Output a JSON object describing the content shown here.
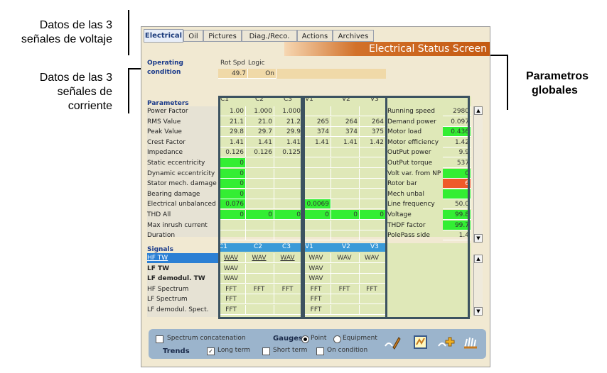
{
  "annotations": {
    "voltage": [
      "Datos de las 3",
      "señales de voltaje"
    ],
    "current": [
      "Datos de las 3",
      "señales de",
      "corriente"
    ],
    "global": [
      "Parametros",
      "globales"
    ]
  },
  "tabs": [
    "Electrical",
    "Oil",
    "Pictures",
    "Diag./Reco.",
    "Actions",
    "Archives"
  ],
  "title": "Electrical Status Screen",
  "operating": {
    "label1": "Operating",
    "label2": "condition",
    "rot_spd": "Rot Spd",
    "logic": "Logic",
    "rot_value": "49.7",
    "logic_value": "On"
  },
  "parameters": {
    "heading": "Parameters",
    "c_headers": [
      "C1",
      "C2",
      "C3"
    ],
    "v_headers": [
      "V1",
      "V2",
      "V3"
    ],
    "rows": [
      {
        "label": "Power Factor",
        "c": [
          "1.00",
          "1.000",
          "1.000"
        ],
        "v": [
          "",
          "",
          ""
        ]
      },
      {
        "label": "RMS Value",
        "c": [
          "21.1",
          "21.0",
          "21.2"
        ],
        "v": [
          "265",
          "264",
          "264"
        ]
      },
      {
        "label": "Peak Value",
        "c": [
          "29.8",
          "29.7",
          "29.9"
        ],
        "v": [
          "374",
          "374",
          "375"
        ]
      },
      {
        "label": "Crest Factor",
        "c": [
          "1.41",
          "1.41",
          "1.41"
        ],
        "v": [
          "1.41",
          "1.41",
          "1.42"
        ]
      },
      {
        "label": "Impedance",
        "c": [
          "0.126",
          "0.126",
          "0.125"
        ],
        "v": [
          "",
          "",
          ""
        ]
      },
      {
        "label": "Static eccentricity",
        "c": [
          "0",
          "",
          ""
        ],
        "v": [
          "",
          "",
          ""
        ]
      },
      {
        "label": "Dynamic eccentricity",
        "c": [
          "0",
          "",
          ""
        ],
        "v": [
          "",
          "",
          ""
        ]
      },
      {
        "label": "Stator mech. damage",
        "c": [
          "0",
          "",
          ""
        ],
        "v": [
          "",
          "",
          ""
        ]
      },
      {
        "label": "Bearing damage",
        "c": [
          "0",
          "",
          ""
        ],
        "v": [
          "",
          "",
          ""
        ]
      },
      {
        "label": "Electrical unbalanced",
        "c": [
          "0.076",
          "",
          ""
        ],
        "v": [
          "0.0069",
          "",
          ""
        ]
      },
      {
        "label": "THD All",
        "c": [
          "0",
          "0",
          "0"
        ],
        "v": [
          "0",
          "0",
          "0"
        ]
      },
      {
        "label": "Max inrush current",
        "c": [
          "",
          "",
          ""
        ],
        "v": [
          "",
          "",
          ""
        ]
      },
      {
        "label": "Duration",
        "c": [
          "",
          "",
          ""
        ],
        "v": [
          "",
          "",
          ""
        ]
      }
    ]
  },
  "global": [
    {
      "label": "Running speed",
      "value": "2980",
      "color": ""
    },
    {
      "label": "Demand power",
      "value": "0.097",
      "color": ""
    },
    {
      "label": "Motor load",
      "value": "0.436",
      "color": "g"
    },
    {
      "label": "Motor efficiency",
      "value": "1.42",
      "color": ""
    },
    {
      "label": "OutPut power",
      "value": "9.9",
      "color": ""
    },
    {
      "label": "OutPut torque",
      "value": "537",
      "color": ""
    },
    {
      "label": "Volt var. from NP",
      "value": "0",
      "color": "g"
    },
    {
      "label": "Rotor bar damage",
      "value": "6",
      "color": "r"
    },
    {
      "label": "Mech unbal misalig",
      "value": "",
      "color": "g"
    },
    {
      "label": "Line frequency",
      "value": "50.0",
      "color": ""
    },
    {
      "label": "Voltage Distorsion",
      "value": "99.8",
      "color": "g"
    },
    {
      "label": "THDF factor",
      "value": "99.7",
      "color": "g"
    },
    {
      "label": "PolePass side band",
      "value": "1.4",
      "color": ""
    }
  ],
  "signals": {
    "heading": "Signals",
    "rows": [
      {
        "label": "HF TW",
        "c": [
          "WAV",
          "WAV",
          "WAV"
        ],
        "v": [
          "WAV",
          "WAV",
          "WAV"
        ],
        "sel": true
      },
      {
        "label": "LF TW",
        "c": [
          "WAV",
          "",
          ""
        ],
        "v": [
          "WAV",
          "",
          ""
        ],
        "bold": true
      },
      {
        "label": "LF demodul. TW",
        "c": [
          "WAV",
          "",
          ""
        ],
        "v": [
          "WAV",
          "",
          ""
        ],
        "bold": true
      },
      {
        "label": "HF Spectrum",
        "c": [
          "FFT",
          "FFT",
          "FFT"
        ],
        "v": [
          "FFT",
          "FFT",
          "FFT"
        ]
      },
      {
        "label": "LF Spectrum",
        "c": [
          "FFT",
          "",
          ""
        ],
        "v": [
          "FFT",
          "",
          ""
        ]
      },
      {
        "label": "LF demodul. Spect.",
        "c": [
          "FFT",
          "",
          ""
        ],
        "v": [
          "FFT",
          "",
          ""
        ]
      }
    ]
  },
  "bottom": {
    "spectrum_concat": "Spectrum concatenation",
    "gauges": "Gauges",
    "point": "Point",
    "equipment": "Equipment",
    "trends": "Trends",
    "long_term": "Long term",
    "short_term": "Short term",
    "on_condition": "On condition"
  }
}
